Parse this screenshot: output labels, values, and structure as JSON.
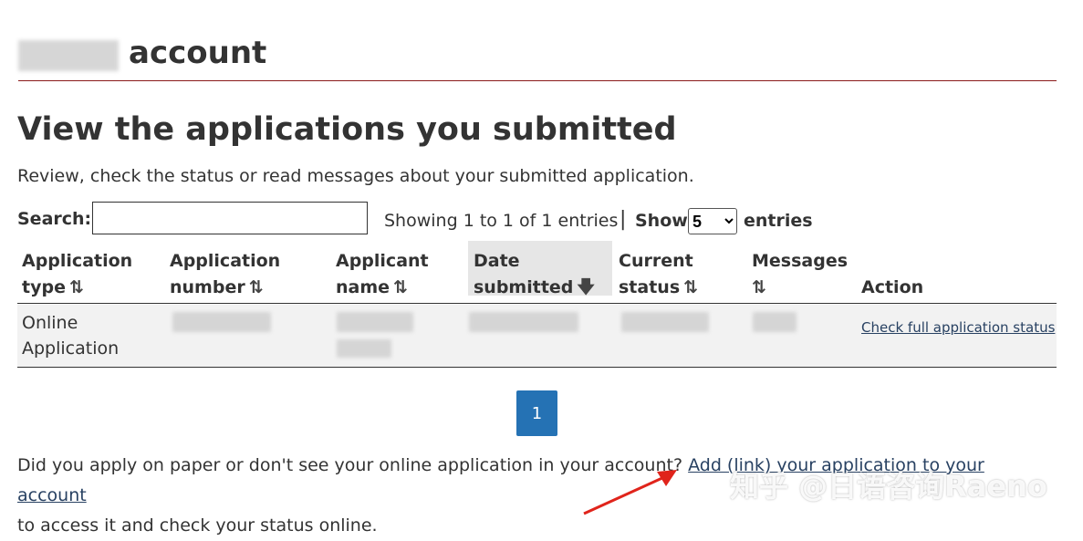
{
  "header": {
    "title_suffix": "account"
  },
  "page": {
    "title": "View the applications you submitted",
    "subtitle": "Review, check the status or read messages about your submitted application."
  },
  "controls": {
    "search_label": "Search:",
    "search_value": "",
    "showing_text": "Showing 1 to 1 of 1 entries",
    "separator": "|",
    "show_label": "Show",
    "entries_value": "5",
    "entries_label": "entries"
  },
  "table": {
    "columns": [
      {
        "line1": "Application",
        "line2": "type",
        "sort": "⇅"
      },
      {
        "line1": "Application",
        "line2": "number",
        "sort": "⇅"
      },
      {
        "line1": "Applicant",
        "line2": "name",
        "sort": "⇅"
      },
      {
        "line1": "Date",
        "line2": "submitted",
        "sort": "🡇"
      },
      {
        "line1": "Current",
        "line2": "status",
        "sort": "⇅"
      },
      {
        "line1": "Messages",
        "line2": "",
        "sort": "⇅"
      },
      {
        "line1": "",
        "line2": "Action",
        "sort": ""
      }
    ],
    "rows": [
      {
        "type_line1": "Online",
        "type_line2": "Application",
        "action": "Check full application status"
      }
    ]
  },
  "pagination": {
    "current_page": "1"
  },
  "footer": {
    "question": "Did you apply on paper or don't see your online application in your account?",
    "link": "Add (link) your application to your account",
    "suffix": "to access it and check your status online."
  },
  "watermark": {
    "text": "知乎 @日语咨询Raeno"
  },
  "colors": {
    "primary": "#2572b4",
    "link": "#284162",
    "rule": "#8b1a1a",
    "row_bg": "#f2f2f2",
    "arrow": "#e0241b"
  }
}
